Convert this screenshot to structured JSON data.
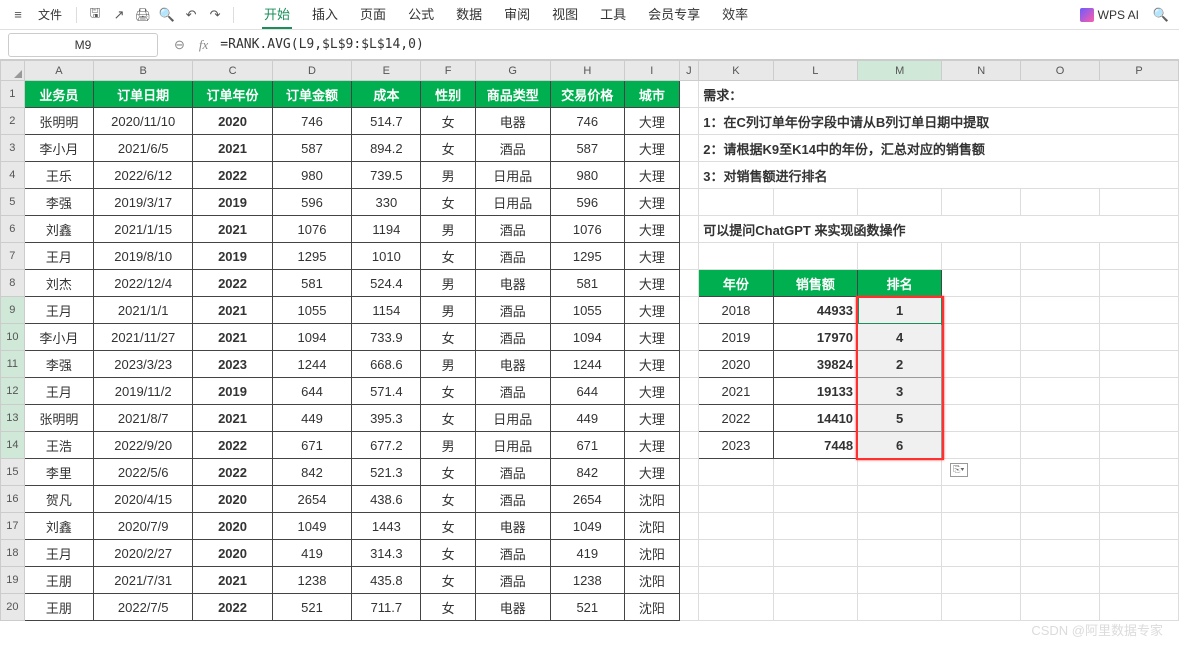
{
  "menu": {
    "file": "文件",
    "tabs": [
      "开始",
      "插入",
      "页面",
      "公式",
      "数据",
      "审阅",
      "视图",
      "工具",
      "会员专享",
      "效率"
    ],
    "active_tab": 0,
    "ai_label": "WPS AI"
  },
  "namebox": "M9",
  "formula": "=RANK.AVG(L9,$L$9:$L$14,0)",
  "columns": [
    "A",
    "B",
    "C",
    "D",
    "E",
    "F",
    "G",
    "H",
    "I",
    "J",
    "K",
    "L",
    "M",
    "N",
    "O",
    "P"
  ],
  "headers": {
    "A": "业务员",
    "B": "订单日期",
    "C": "订单年份",
    "D": "订单金额",
    "E": "成本",
    "F": "性别",
    "G": "商品类型",
    "H": "交易价格",
    "I": "城市"
  },
  "rows": [
    {
      "r": 2,
      "A": "张明明",
      "B": "2020/11/10",
      "C": "2020",
      "D": "746",
      "E": "514.7",
      "F": "女",
      "G": "电器",
      "H": "746",
      "I": "大理"
    },
    {
      "r": 3,
      "A": "李小月",
      "B": "2021/6/5",
      "C": "2021",
      "D": "587",
      "E": "894.2",
      "F": "女",
      "G": "酒品",
      "H": "587",
      "I": "大理"
    },
    {
      "r": 4,
      "A": "王乐",
      "B": "2022/6/12",
      "C": "2022",
      "D": "980",
      "E": "739.5",
      "F": "男",
      "G": "日用品",
      "H": "980",
      "I": "大理"
    },
    {
      "r": 5,
      "A": "李强",
      "B": "2019/3/17",
      "C": "2019",
      "D": "596",
      "E": "330",
      "F": "女",
      "G": "日用品",
      "H": "596",
      "I": "大理"
    },
    {
      "r": 6,
      "A": "刘鑫",
      "B": "2021/1/15",
      "C": "2021",
      "D": "1076",
      "E": "1194",
      "F": "男",
      "G": "酒品",
      "H": "1076",
      "I": "大理"
    },
    {
      "r": 7,
      "A": "王月",
      "B": "2019/8/10",
      "C": "2019",
      "D": "1295",
      "E": "1010",
      "F": "女",
      "G": "酒品",
      "H": "1295",
      "I": "大理"
    },
    {
      "r": 8,
      "A": "刘杰",
      "B": "2022/12/4",
      "C": "2022",
      "D": "581",
      "E": "524.4",
      "F": "男",
      "G": "电器",
      "H": "581",
      "I": "大理"
    },
    {
      "r": 9,
      "A": "王月",
      "B": "2021/1/1",
      "C": "2021",
      "D": "1055",
      "E": "1154",
      "F": "男",
      "G": "酒品",
      "H": "1055",
      "I": "大理"
    },
    {
      "r": 10,
      "A": "李小月",
      "B": "2021/11/27",
      "C": "2021",
      "D": "1094",
      "E": "733.9",
      "F": "女",
      "G": "酒品",
      "H": "1094",
      "I": "大理"
    },
    {
      "r": 11,
      "A": "李强",
      "B": "2023/3/23",
      "C": "2023",
      "D": "1244",
      "E": "668.6",
      "F": "男",
      "G": "电器",
      "H": "1244",
      "I": "大理"
    },
    {
      "r": 12,
      "A": "王月",
      "B": "2019/11/2",
      "C": "2019",
      "D": "644",
      "E": "571.4",
      "F": "女",
      "G": "酒品",
      "H": "644",
      "I": "大理"
    },
    {
      "r": 13,
      "A": "张明明",
      "B": "2021/8/7",
      "C": "2021",
      "D": "449",
      "E": "395.3",
      "F": "女",
      "G": "日用品",
      "H": "449",
      "I": "大理"
    },
    {
      "r": 14,
      "A": "王浩",
      "B": "2022/9/20",
      "C": "2022",
      "D": "671",
      "E": "677.2",
      "F": "男",
      "G": "日用品",
      "H": "671",
      "I": "大理"
    },
    {
      "r": 15,
      "A": "李里",
      "B": "2022/5/6",
      "C": "2022",
      "D": "842",
      "E": "521.3",
      "F": "女",
      "G": "酒品",
      "H": "842",
      "I": "大理"
    },
    {
      "r": 16,
      "A": "贺凡",
      "B": "2020/4/15",
      "C": "2020",
      "D": "2654",
      "E": "438.6",
      "F": "女",
      "G": "酒品",
      "H": "2654",
      "I": "沈阳"
    },
    {
      "r": 17,
      "A": "刘鑫",
      "B": "2020/7/9",
      "C": "2020",
      "D": "1049",
      "E": "1443",
      "F": "女",
      "G": "电器",
      "H": "1049",
      "I": "沈阳"
    },
    {
      "r": 18,
      "A": "王月",
      "B": "2020/2/27",
      "C": "2020",
      "D": "419",
      "E": "314.3",
      "F": "女",
      "G": "酒品",
      "H": "419",
      "I": "沈阳"
    },
    {
      "r": 19,
      "A": "王朋",
      "B": "2021/7/31",
      "C": "2021",
      "D": "1238",
      "E": "435.8",
      "F": "女",
      "G": "酒品",
      "H": "1238",
      "I": "沈阳"
    },
    {
      "r": 20,
      "A": "王朋",
      "B": "2022/7/5",
      "C": "2022",
      "D": "521",
      "E": "711.7",
      "F": "女",
      "G": "电器",
      "H": "521",
      "I": "沈阳"
    }
  ],
  "requirements": {
    "title": "需求：",
    "l1": "1：在C列订单年份字段中请从B列订单日期中提取",
    "l2": "2：请根据K9至K14中的年份，汇总对应的销售额",
    "l3": "3：对销售额进行排名",
    "hint": "可以提问ChatGPT 来实现函数操作"
  },
  "summary_headers": {
    "K": "年份",
    "L": "销售额",
    "M": "排名"
  },
  "summary": [
    {
      "r": 9,
      "K": "2018",
      "L": "44933",
      "M": "1"
    },
    {
      "r": 10,
      "K": "2019",
      "L": "17970",
      "M": "4"
    },
    {
      "r": 11,
      "K": "2020",
      "L": "39824",
      "M": "2"
    },
    {
      "r": 12,
      "K": "2021",
      "L": "19133",
      "M": "3"
    },
    {
      "r": 13,
      "K": "2022",
      "L": "14410",
      "M": "5"
    },
    {
      "r": 14,
      "K": "2023",
      "L": "7448",
      "M": "6"
    }
  ],
  "watermark": "CSDN @阿里数据专家"
}
